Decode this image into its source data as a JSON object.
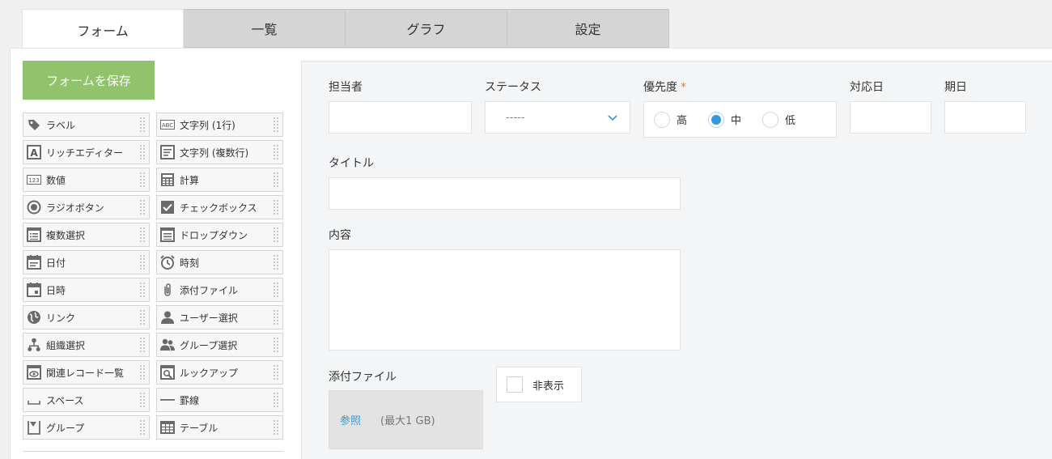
{
  "tabs": [
    {
      "label": "フォーム",
      "active": true
    },
    {
      "label": "一覧",
      "active": false
    },
    {
      "label": "グラフ",
      "active": false
    },
    {
      "label": "設定",
      "active": false
    }
  ],
  "save_button": {
    "label": "フォームを保存",
    "color": "#91c36c"
  },
  "palette": [
    {
      "label": "ラベル",
      "icon": "tag-icon"
    },
    {
      "label": "文字列 (1行)",
      "icon": "text-abc-icon"
    },
    {
      "label": "リッチエディター",
      "icon": "rich-editor-icon"
    },
    {
      "label": "文字列 (複数行)",
      "icon": "multiline-text-icon"
    },
    {
      "label": "数値",
      "icon": "number-icon"
    },
    {
      "label": "計算",
      "icon": "calculator-icon"
    },
    {
      "label": "ラジオボタン",
      "icon": "radio-icon"
    },
    {
      "label": "チェックボックス",
      "icon": "checkbox-icon"
    },
    {
      "label": "複数選択",
      "icon": "multi-select-icon"
    },
    {
      "label": "ドロップダウン",
      "icon": "dropdown-icon"
    },
    {
      "label": "日付",
      "icon": "date-icon"
    },
    {
      "label": "時刻",
      "icon": "alarm-clock-icon"
    },
    {
      "label": "日時",
      "icon": "datetime-icon"
    },
    {
      "label": "添付ファイル",
      "icon": "paperclip-icon"
    },
    {
      "label": "リンク",
      "icon": "globe-icon"
    },
    {
      "label": "ユーザー選択",
      "icon": "user-icon"
    },
    {
      "label": "組織選択",
      "icon": "org-icon"
    },
    {
      "label": "グループ選択",
      "icon": "group-icon"
    },
    {
      "label": "関連レコード一覧",
      "icon": "related-records-icon"
    },
    {
      "label": "ルックアップ",
      "icon": "lookup-icon"
    },
    {
      "label": "スペース",
      "icon": "space-icon"
    },
    {
      "label": "罫線",
      "icon": "line-icon"
    },
    {
      "label": "グループ",
      "icon": "group-field-icon"
    },
    {
      "label": "テーブル",
      "icon": "table-icon"
    }
  ],
  "form": {
    "assignee": {
      "label": "担当者",
      "value": ""
    },
    "status": {
      "label": "ステータス",
      "value": "-----"
    },
    "priority": {
      "label": "優先度",
      "required_mark": "*",
      "options": [
        "高",
        "中",
        "低"
      ],
      "selected": "中"
    },
    "handled_date": {
      "label": "対応日",
      "value": ""
    },
    "due_date": {
      "label": "期日",
      "value": ""
    },
    "title": {
      "label": "タイトル",
      "value": ""
    },
    "content": {
      "label": "内容",
      "value": ""
    },
    "attachment": {
      "label": "添付ファイル",
      "browse": "参照",
      "limit": "(最大1 GB)"
    },
    "hide": {
      "label": "非表示",
      "checked": false
    }
  },
  "colors": {
    "accent": "#3498db",
    "required": "#e07b39",
    "save": "#91c36c"
  }
}
